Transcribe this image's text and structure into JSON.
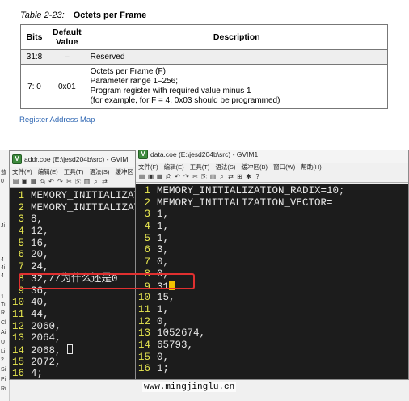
{
  "doc": {
    "caption_number": "Table 2-23:",
    "caption_title": "Octets per Frame",
    "table": {
      "headers": [
        "Bits",
        "Default Value",
        "Description"
      ],
      "rows": [
        {
          "bits": "31:8",
          "default": "–",
          "description": [
            "Reserved"
          ]
        },
        {
          "bits": "7: 0",
          "default": "0x01",
          "description": [
            "Octets per Frame (F)",
            "Parameter range 1–256;",
            "Program register with required value minus 1",
            "(for example, for F = 4, 0x03 should be programmed)"
          ]
        }
      ]
    },
    "link_text": "Register Address Map"
  },
  "left_window": {
    "title": "addr.coe (E:\\jesd204b\\src) - GVIM",
    "menu": [
      "文件(F)",
      "编辑(E)",
      "工具(T)",
      "语法(S)",
      "缓冲区"
    ],
    "lines": [
      {
        "n": "1",
        "text": "MEMORY_INITIALIZAT"
      },
      {
        "n": "2",
        "text": "MEMORY_INITIALIZAT"
      },
      {
        "n": "3",
        "text": "8,"
      },
      {
        "n": "4",
        "text": "12,"
      },
      {
        "n": "5",
        "text": "16,"
      },
      {
        "n": "6",
        "text": "20,"
      },
      {
        "n": "7",
        "text": "24,"
      },
      {
        "n": "8",
        "text": "32,//为什么还是0"
      },
      {
        "n": "9",
        "text": "36,"
      },
      {
        "n": "10",
        "text": "40,"
      },
      {
        "n": "11",
        "text": "44,"
      },
      {
        "n": "12",
        "text": "2060,"
      },
      {
        "n": "13",
        "text": "2064,"
      },
      {
        "n": "14",
        "text": "2068,"
      },
      {
        "n": "15",
        "text": "2072,"
      },
      {
        "n": "16",
        "text": "4;"
      }
    ]
  },
  "right_window": {
    "title": "data.coe (E:\\jesd204b\\src) - GVIM1",
    "menu": [
      "文件(F)",
      "编辑(E)",
      "工具(T)",
      "语法(S)",
      "缓冲区(B)",
      "窗口(W)",
      "帮助(H)"
    ],
    "lines": [
      {
        "n": "1",
        "text": "MEMORY_INITIALIZATION_RADIX=10;"
      },
      {
        "n": "2",
        "text": "MEMORY_INITIALIZATION_VECTOR="
      },
      {
        "n": "3",
        "text": "1,"
      },
      {
        "n": "4",
        "text": "1,"
      },
      {
        "n": "5",
        "text": "1,"
      },
      {
        "n": "6",
        "text": "3,"
      },
      {
        "n": "7",
        "text": "0,"
      },
      {
        "n": "8",
        "text": "0,"
      },
      {
        "n": "9",
        "text": "31"
      },
      {
        "n": "10",
        "text": "15,"
      },
      {
        "n": "11",
        "text": "1,"
      },
      {
        "n": "12",
        "text": "0,"
      },
      {
        "n": "13",
        "text": "1052674,"
      },
      {
        "n": "14",
        "text": "65793,"
      },
      {
        "n": "15",
        "text": "0,"
      },
      {
        "n": "16",
        "text": "1;"
      }
    ],
    "tilde": "~"
  },
  "watermark": "www.mingjinglu.cn",
  "colors": {
    "line_number": "#e8e850",
    "editor_bg": "#1c1c1c",
    "highlight_box": "#e03030",
    "link": "#2f67b3",
    "cursor": "#f2c200"
  },
  "icons": {
    "app": "gvim-icon",
    "toolbar": [
      "open-icon",
      "save-icon",
      "save-all-icon",
      "print-icon",
      "undo-icon",
      "redo-icon",
      "cut-icon",
      "copy-icon",
      "paste-icon",
      "find-icon",
      "replace-icon"
    ]
  }
}
